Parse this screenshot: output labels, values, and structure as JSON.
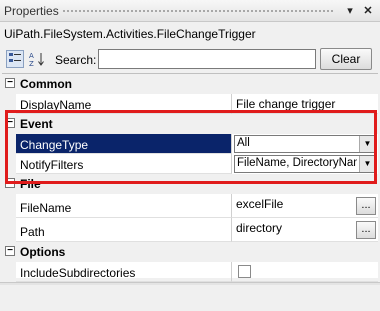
{
  "panel": {
    "title": "Properties",
    "pin_glyph": "▾",
    "close_glyph": "✕"
  },
  "object_type": "UiPath.FileSystem.Activities.FileChangeTrigger",
  "toolbar": {
    "categorized_icon": "categorized-icon",
    "alphabetical_icon": "sort-az-icon",
    "search_label": "Search:",
    "search_value": "",
    "clear_label": "Clear"
  },
  "categories": {
    "common": {
      "label": "Common",
      "toggle": "−"
    },
    "event": {
      "label": "Event",
      "toggle": "−"
    },
    "file": {
      "label": "File",
      "toggle": "−"
    },
    "options": {
      "label": "Options",
      "toggle": "−"
    }
  },
  "properties": {
    "display_name": {
      "name": "DisplayName",
      "value": "File change trigger"
    },
    "change_type": {
      "name": "ChangeType",
      "value": "All"
    },
    "notify_filters": {
      "name": "NotifyFilters",
      "value": "FileName, DirectoryName"
    },
    "file_name": {
      "name": "FileName",
      "value": "excelFile"
    },
    "path": {
      "name": "Path",
      "value": "directory"
    },
    "include_subdirectories": {
      "name": "IncludeSubdirectories",
      "checked": false
    }
  },
  "highlight_color": "#e01b1b",
  "selection_color": "#0a246a"
}
